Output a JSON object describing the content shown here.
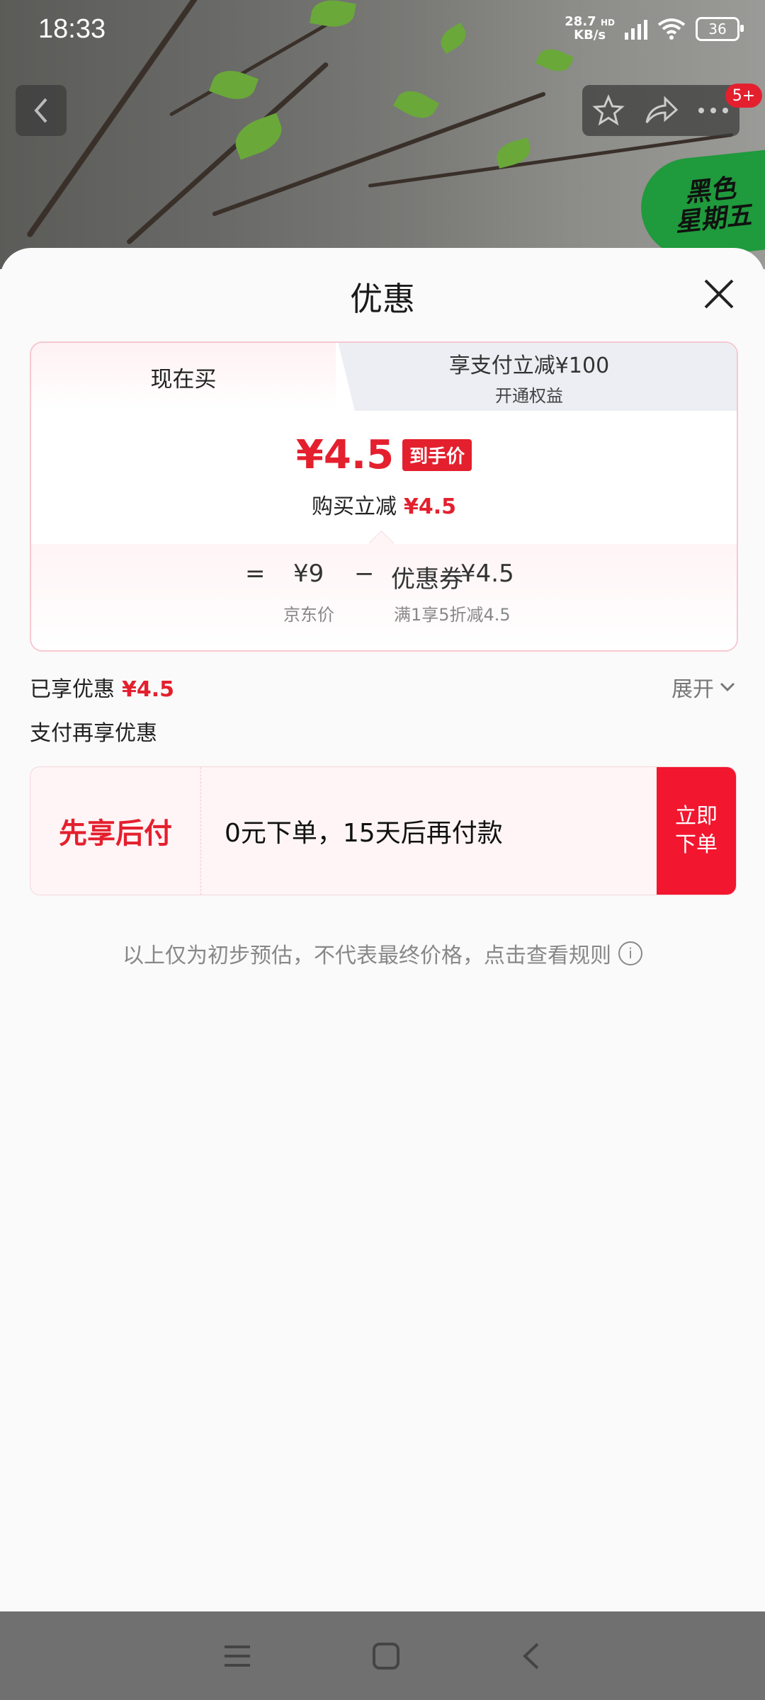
{
  "status_bar": {
    "time": "18:33",
    "speed_top": "28.7",
    "speed_unit": "KB/s",
    "hd": "HD",
    "battery": "36"
  },
  "top_bar": {
    "badge": "5+",
    "promo_line1": "黑色",
    "promo_line2": "星期五"
  },
  "sheet": {
    "title": "优惠",
    "tabs": {
      "now": "现在买",
      "pay_line1": "享支付立减¥100",
      "pay_line2": "开通权益"
    },
    "final_price": "¥4.5",
    "final_tag": "到手价",
    "reduce_label": "购买立减",
    "reduce_value": "¥4.5",
    "calc": {
      "equals": "=",
      "base_price": "¥9",
      "minus": "−",
      "coupon_label": "优惠券",
      "coupon_value": "¥4.5",
      "base_sub": "京东价",
      "coupon_sub": "满1享5折减4.5"
    },
    "enjoyed_label": "已享优惠",
    "enjoyed_value": "¥4.5",
    "expand_label": "展开",
    "pay_again_label": "支付再享优惠",
    "bnpl": {
      "name": "先享后付",
      "desc": "0元下单，15天后再付款",
      "order_line1": "立即",
      "order_line2": "下单"
    },
    "disclaimer": "以上仅为初步预估，不代表最终价格，点击查看规则"
  },
  "colors": {
    "accent": "#e4202e",
    "button": "#f2162f"
  }
}
